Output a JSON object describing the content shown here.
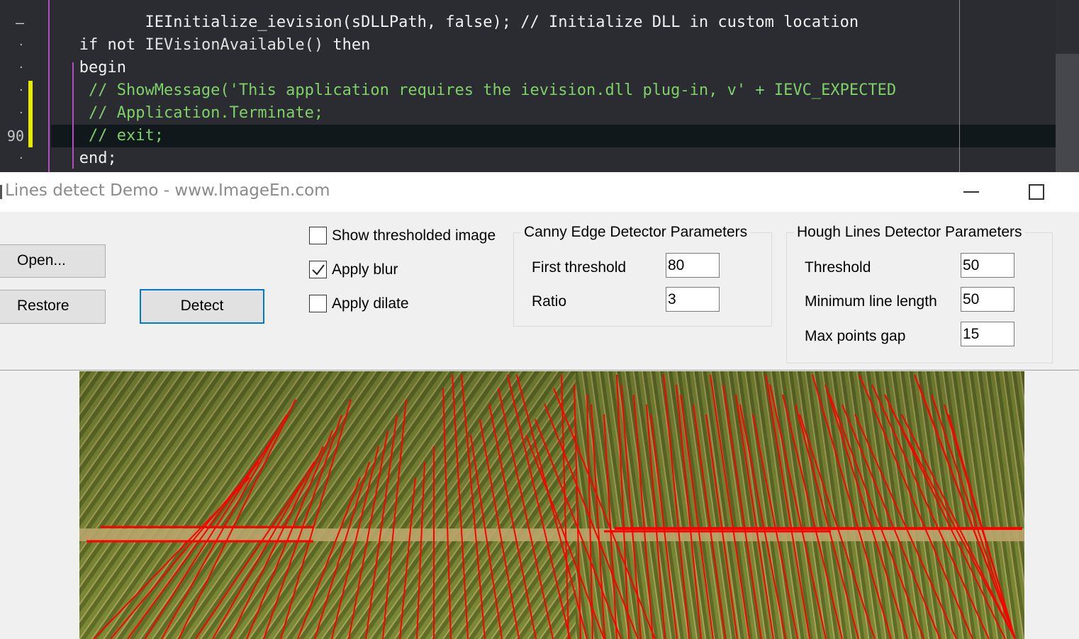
{
  "editor": {
    "gutter": [
      {
        "text": "–",
        "row": 0,
        "tick": false
      },
      {
        "text": "·",
        "row": 1,
        "tick": true
      },
      {
        "text": "·",
        "row": 2,
        "tick": true
      },
      {
        "text": "·",
        "row": 3,
        "tick": true
      },
      {
        "text": "·",
        "row": 4,
        "tick": true
      },
      {
        "text": "90",
        "row": 5,
        "tick": false
      },
      {
        "text": "·",
        "row": 6,
        "tick": true
      }
    ],
    "lines": {
      "l0": "    IEInitialize_ievision(sDLLPath, false); // Initialize DLL in custom location",
      "l1_kw1": "if",
      "l1_kw2": "not",
      "l1_fn": "IEVisionAvailable()",
      "l1_kw3": "then",
      "l2": "begin",
      "l3": "// ShowMessage('This application requires the ievision.dll plug-in, v' + IEVC_EXPECTED",
      "l4": "// Application.Terminate;",
      "l5": "// exit;",
      "l6": "end;"
    }
  },
  "window": {
    "title": "Lines detect Demo - www.ImageEn.com"
  },
  "buttons": {
    "open": "Open...",
    "restore": "Restore",
    "detect": "Detect"
  },
  "checkboxes": {
    "show_thresholded": {
      "label": "Show thresholded image",
      "checked": false
    },
    "apply_blur": {
      "label": "Apply blur",
      "checked": true
    },
    "apply_dilate": {
      "label": "Apply dilate",
      "checked": false
    }
  },
  "canny": {
    "title": "Canny Edge Detector Parameters",
    "first_threshold_label": "First threshold",
    "first_threshold_value": "80",
    "ratio_label": "Ratio",
    "ratio_value": "3"
  },
  "hough": {
    "title": "Hough Lines Detector Parameters",
    "threshold_label": "Threshold",
    "threshold_value": "50",
    "min_length_label": "Minimum line length",
    "min_length_value": "50",
    "max_gap_label": "Max points gap",
    "max_gap_value": "15"
  },
  "colors": {
    "detected_line": "#ff0000",
    "field_green": "#6e7a2e",
    "accent": "#0078d7"
  }
}
